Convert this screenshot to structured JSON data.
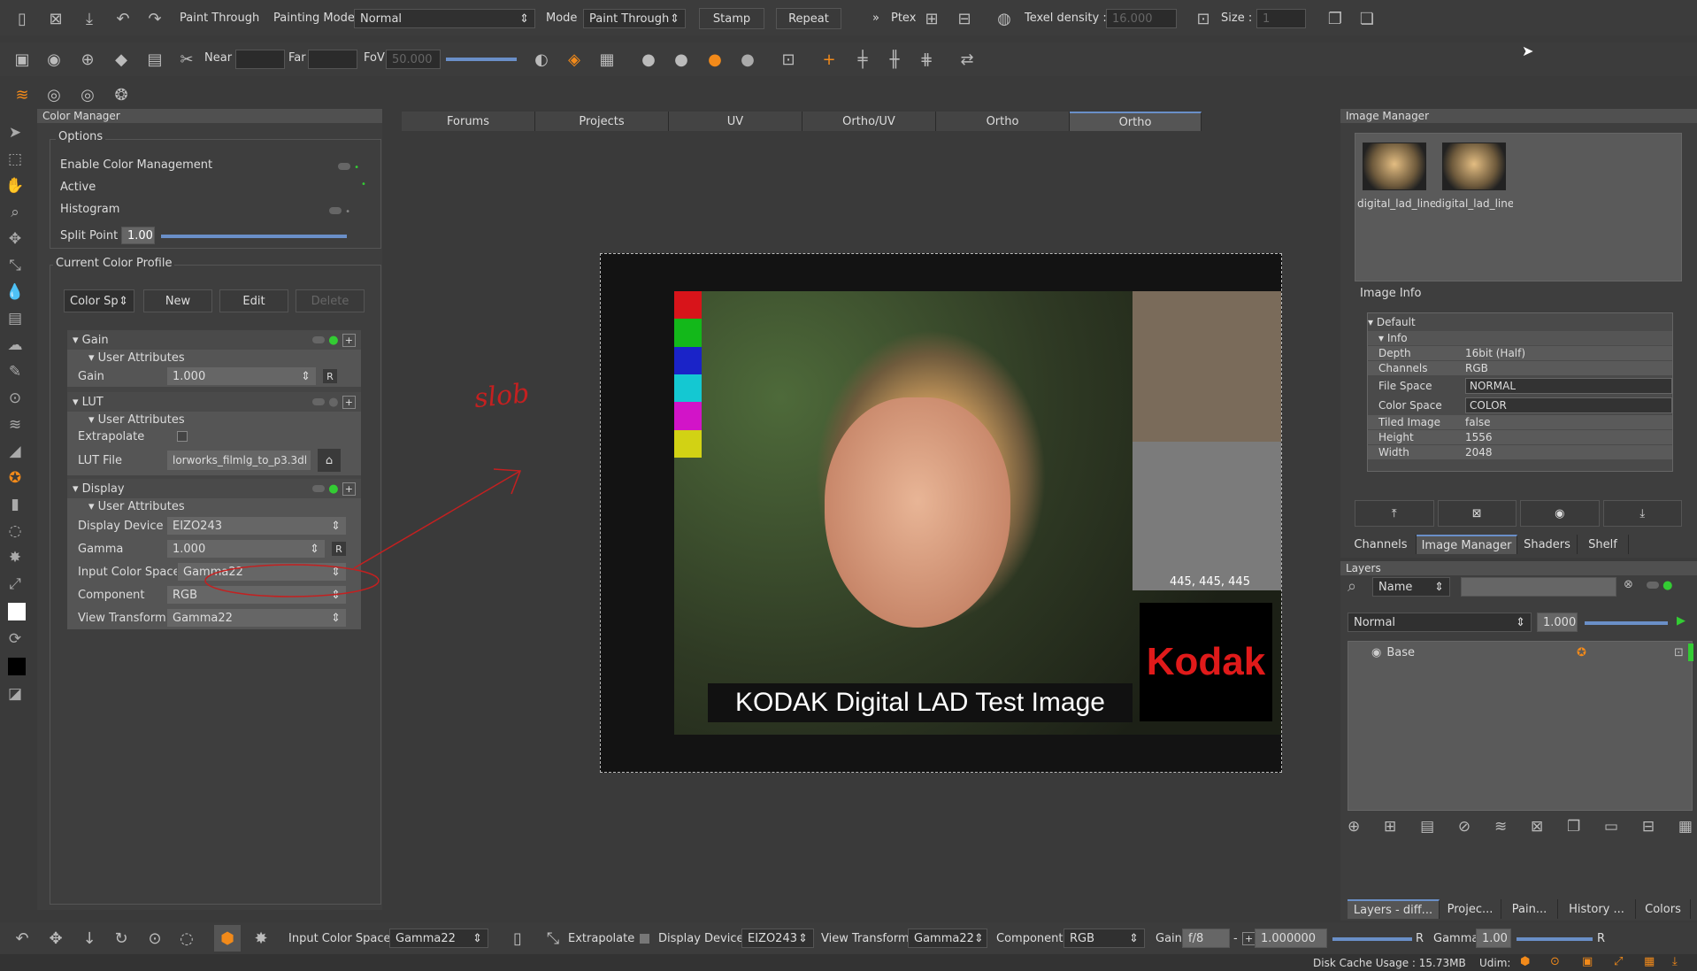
{
  "top_toolbar": {
    "painting_label": "Paint Through",
    "painting_mode_label": "Painting Mode",
    "painting_mode_value": "Normal",
    "mode_label": "Mode",
    "mode_value": "Paint Through",
    "stamp_label": "Stamp",
    "repeat_label": "Repeat",
    "overflow": "»",
    "ptex_label": "Ptex",
    "texel_label": "Texel density :",
    "texel_value": "16.000",
    "size_label": "Size :",
    "size_value": "1"
  },
  "second_toolbar": {
    "near_label": "Near",
    "far_label": "Far",
    "fov_label": "FoV",
    "fov_value": "50.000"
  },
  "color_manager": {
    "title": "Color Manager",
    "options_title": "Options",
    "enable_label": "Enable Color Management",
    "active_label": "Active",
    "histogram_label": "Histogram",
    "split_label": "Split Point",
    "split_value": "1.00",
    "profile_title": "Current Color Profile",
    "profile_select": "Color Sp",
    "new_label": "New",
    "edit_label": "Edit",
    "delete_label": "Delete",
    "gain_section": "Gain",
    "user_attr": "User Attributes",
    "gain_label": "Gain",
    "gain_value": "1.000",
    "r_label": "R",
    "lut_section": "LUT",
    "extrapolate_label": "Extrapolate",
    "lut_file_label": "LUT File",
    "lut_file_value": "lorworks_filmlg_to_p3.3dl",
    "display_section": "Display",
    "display_device_label": "Display Device",
    "display_device_value": "EIZO243",
    "gamma_label": "Gamma",
    "gamma_value": "1.000",
    "input_cs_label": "Input Color Space",
    "input_cs_value": "Gamma22",
    "component_label": "Component",
    "component_value": "RGB",
    "view_transform_label": "View Transform",
    "view_transform_value": "Gamma22"
  },
  "viewport": {
    "tabs": [
      "Forums",
      "Projects",
      "UV",
      "Ortho/UV",
      "Ortho",
      "Ortho"
    ],
    "active_tab": 5,
    "annotation": "slob",
    "image_caption": "KODAK Digital LAD Test Image",
    "kodak_logo": "Kodak",
    "rgb_readout": "445, 445, 445",
    "swatches": [
      "#d8141a",
      "#13b81a",
      "#1a23c8",
      "#14c8d2",
      "#d214c8",
      "#d2d214"
    ]
  },
  "image_manager": {
    "title": "Image Manager",
    "thumbs": [
      "digital_lad_line",
      "digital_lad_line"
    ],
    "info_title": "Image Info",
    "default_label": "Default",
    "info_label": "Info",
    "rows": [
      {
        "k": "Depth",
        "v": "16bit (Half)"
      },
      {
        "k": "Channels",
        "v": "RGB"
      },
      {
        "k": "File Space",
        "v": "NORMAL"
      },
      {
        "k": "Color Space",
        "v": "COLOR"
      },
      {
        "k": "Tiled Image",
        "v": "false"
      },
      {
        "k": "Height",
        "v": "1556"
      },
      {
        "k": "Width",
        "v": "2048"
      }
    ],
    "tabs": [
      "Channels",
      "Image Manager",
      "Shaders",
      "Shelf"
    ]
  },
  "layers": {
    "title": "Layers",
    "filter_select": "Name",
    "blend_mode": "Normal",
    "opacity": "1.000",
    "base_layer": "Base",
    "bottom_tabs": [
      "Layers - diff...",
      "Projec...",
      "Pain...",
      "History ...",
      "Colors"
    ]
  },
  "bottom_toolbar": {
    "input_cs_label": "Input Color Space",
    "input_cs_value": "Gamma22",
    "extrapolate_label": "Extrapolate",
    "display_device_label": "Display Device",
    "display_device_value": "EIZO243",
    "view_transform_label": "View Transform",
    "view_transform_value": "Gamma22",
    "component_label": "Component",
    "component_value": "RGB",
    "gain_label": "Gain",
    "gain_value": "f/8",
    "gain_num": "1.000000",
    "r_label": "R",
    "gamma_label": "Gamma",
    "gamma_value": "1.00",
    "r2_label": "R"
  },
  "status": {
    "disk_cache": "Disk Cache Usage : 15.73MB",
    "udim": "Udim:"
  }
}
